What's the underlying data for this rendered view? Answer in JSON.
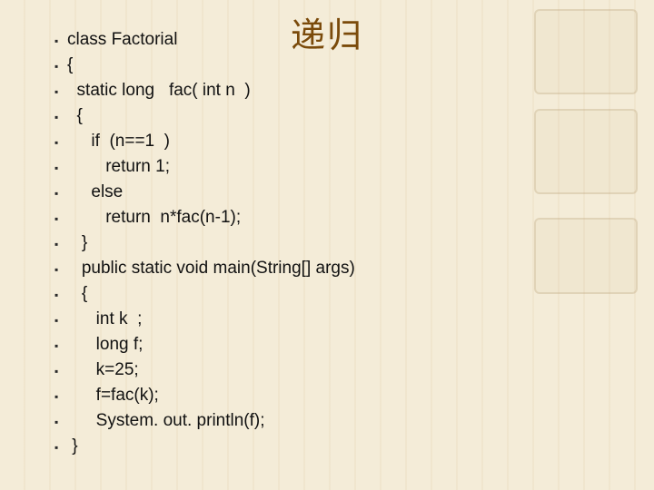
{
  "title": "递归",
  "code": {
    "lines": [
      "class Factorial",
      "{",
      "  static long   fac( int n  )",
      "  {",
      "     if  (n==1  )",
      "        return 1;",
      "     else",
      "        return  n*fac(n-1);",
      "   }",
      "   public static void main(String[] args)",
      "   {",
      "      int k  ;",
      "      long f;",
      "      k=25;",
      "      f=fac(k);",
      "      System. out. println(f);",
      " }"
    ],
    "bullet": "▪"
  }
}
